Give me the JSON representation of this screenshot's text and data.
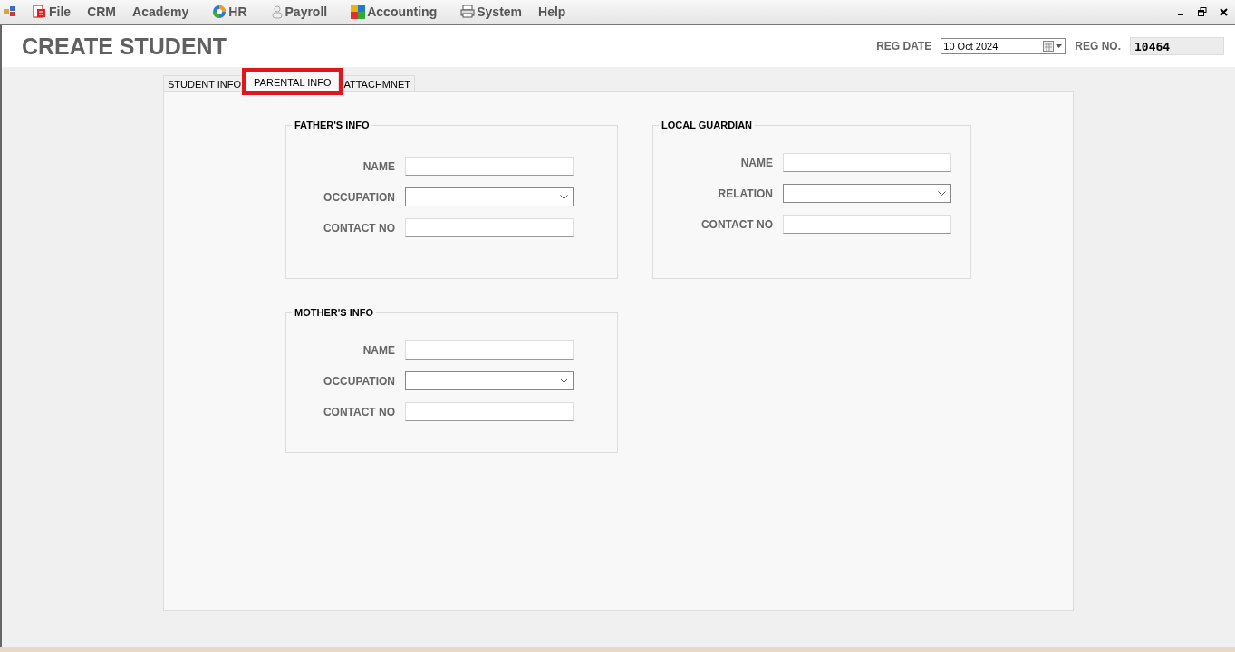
{
  "menu": [
    {
      "label": "File"
    },
    {
      "label": "CRM"
    },
    {
      "label": "Academy"
    },
    {
      "label": "HR"
    },
    {
      "label": "Payroll"
    },
    {
      "label": "Accounting"
    },
    {
      "label": "System"
    },
    {
      "label": "Help"
    }
  ],
  "header": {
    "title": "CREATE STUDENT",
    "reg_date_label": "REG DATE",
    "reg_date": "10 Oct  2024",
    "reg_no_label": "REG NO.",
    "reg_no": "10464"
  },
  "tabs": [
    {
      "label": "STUDENT INFO",
      "selected": false,
      "highlighted": false
    },
    {
      "label": "PARENTAL INFO",
      "selected": true,
      "highlighted": true
    },
    {
      "label": "ATTACHMNET",
      "selected": false,
      "highlighted": false
    }
  ],
  "groups": [
    {
      "title": "FATHER'S INFO",
      "fields": [
        {
          "label": "NAME",
          "kind": "text"
        },
        {
          "label": "OCCUPATION",
          "kind": "dropdown"
        },
        {
          "label": "CONTACT NO",
          "kind": "text"
        }
      ]
    },
    {
      "title": "LOCAL GUARDIAN",
      "fields": [
        {
          "label": "NAME",
          "kind": "text"
        },
        {
          "label": "RELATION",
          "kind": "dropdown"
        },
        {
          "label": "CONTACT NO",
          "kind": "text"
        }
      ]
    },
    {
      "title": "MOTHER'S INFO",
      "fields": [
        {
          "label": "NAME",
          "kind": "text"
        },
        {
          "label": "OCCUPATION",
          "kind": "dropdown"
        },
        {
          "label": "CONTACT NO",
          "kind": "text"
        }
      ]
    }
  ]
}
